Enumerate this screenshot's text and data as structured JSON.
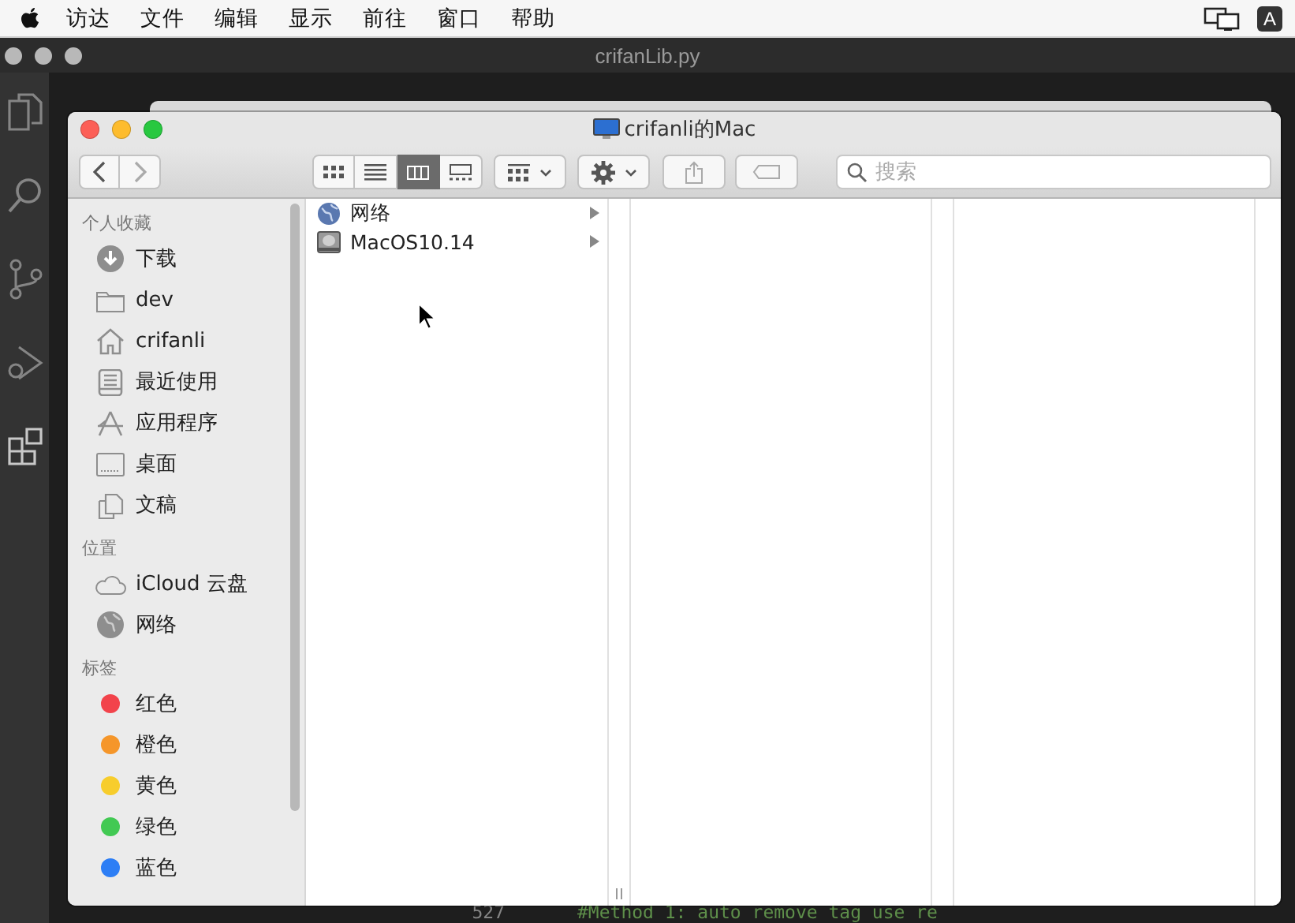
{
  "menu_bar": {
    "items": [
      "访达",
      "文件",
      "编辑",
      "显示",
      "前往",
      "窗口",
      "帮助"
    ],
    "input_source": "A"
  },
  "editor": {
    "title": "crifanLib.py",
    "line_number": "527",
    "code_line": "#Method 1: auto remove tag use re"
  },
  "finder": {
    "title": "crifanli的Mac",
    "view_buttons": [
      {
        "kind": "icons",
        "selected": false
      },
      {
        "kind": "list",
        "selected": false
      },
      {
        "kind": "columns",
        "selected": true
      },
      {
        "kind": "gallery",
        "selected": false
      }
    ],
    "search": {
      "placeholder": "搜索"
    },
    "sidebar": [
      {
        "heading": "个人收藏",
        "items": [
          {
            "label": "下载",
            "kind": "download"
          },
          {
            "label": "dev",
            "kind": "folder"
          },
          {
            "label": "crifanli",
            "kind": "home"
          },
          {
            "label": "最近使用",
            "kind": "recent"
          },
          {
            "label": "应用程序",
            "kind": "apps"
          },
          {
            "label": "桌面",
            "kind": "desktop"
          },
          {
            "label": "文稿",
            "kind": "documents"
          }
        ]
      },
      {
        "heading": "位置",
        "items": [
          {
            "label": "iCloud 云盘",
            "kind": "cloud"
          },
          {
            "label": "网络",
            "kind": "network"
          }
        ]
      },
      {
        "heading": "标签",
        "items": [
          {
            "label": "红色",
            "kind": "tag",
            "color": "#f2434b"
          },
          {
            "label": "橙色",
            "kind": "tag",
            "color": "#f5962a"
          },
          {
            "label": "黄色",
            "kind": "tag",
            "color": "#f7cd2c"
          },
          {
            "label": "绿色",
            "kind": "tag",
            "color": "#42c953"
          },
          {
            "label": "蓝色",
            "kind": "tag",
            "color": "#2d7ef5"
          }
        ]
      }
    ],
    "column_items": [
      {
        "name": "网络",
        "kind": "network"
      },
      {
        "name": "MacOS10.14",
        "kind": "disk"
      }
    ]
  }
}
